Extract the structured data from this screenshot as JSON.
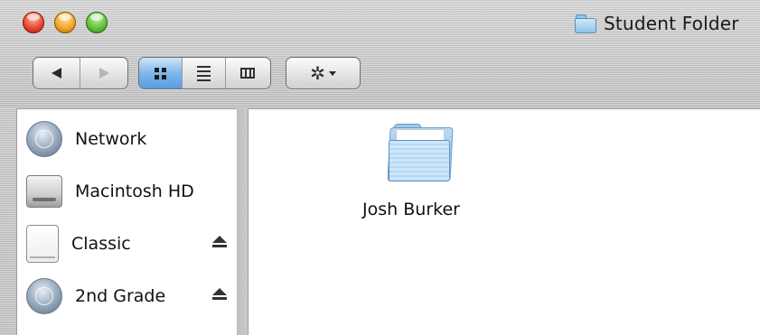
{
  "window": {
    "title": "Student Folder",
    "title_icon": "folder-icon",
    "traffic_lights": {
      "close": "#e8442e",
      "minimize": "#f2a523",
      "zoom": "#62c03a"
    }
  },
  "toolbar": {
    "nav": {
      "back_icon": "back-arrow-icon",
      "forward_icon": "forward-arrow-icon"
    },
    "view_modes": [
      {
        "name": "icon-view",
        "icon": "grid-icon",
        "active": true
      },
      {
        "name": "list-view",
        "icon": "list-icon",
        "active": false
      },
      {
        "name": "column-view",
        "icon": "columns-icon",
        "active": false
      }
    ],
    "action_menu": {
      "icon": "gear-icon",
      "dropdown": "caret-down-icon"
    }
  },
  "sidebar": {
    "items": [
      {
        "label": "Network",
        "icon": "globe-icon",
        "ejectable": false
      },
      {
        "label": "Macintosh HD",
        "icon": "hard-drive-icon",
        "ejectable": false
      },
      {
        "label": "Classic",
        "icon": "disk-icon",
        "ejectable": true
      },
      {
        "label": "2nd Grade",
        "icon": "network-volume-icon",
        "ejectable": true
      }
    ]
  },
  "main": {
    "files": [
      {
        "label": "Josh Burker",
        "icon": "folder-icon"
      }
    ]
  },
  "colors": {
    "selection_blue": "#7fb6ea",
    "chrome_gray": "#c4c4c4"
  }
}
